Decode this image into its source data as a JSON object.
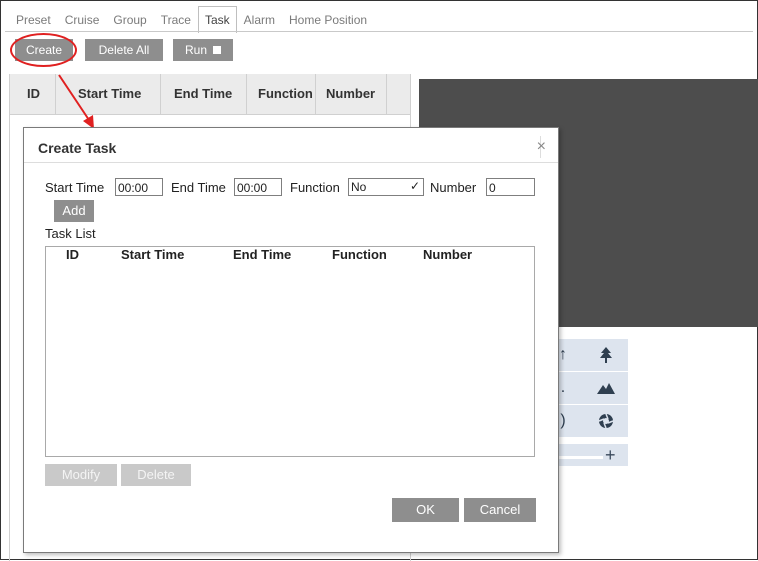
{
  "tabs": [
    {
      "label": "Preset",
      "active": false
    },
    {
      "label": "Cruise",
      "active": false
    },
    {
      "label": "Group",
      "active": false
    },
    {
      "label": "Trace",
      "active": false
    },
    {
      "label": "Task",
      "active": true
    },
    {
      "label": "Alarm",
      "active": false
    },
    {
      "label": "Home Position",
      "active": false
    }
  ],
  "toolbar": {
    "create_label": "Create",
    "delete_all_label": "Delete All",
    "run_label": "Run"
  },
  "background_table": {
    "columns": [
      "ID",
      "Start Time",
      "End Time",
      "Function",
      "Number"
    ]
  },
  "ptz_icons": [
    "tree-small-icon",
    "tree-large-icon",
    "mountain-small-icon",
    "mountain-large-icon",
    "iris-close-icon",
    "iris-open-icon"
  ],
  "zoom_plus": "+",
  "modal": {
    "title": "Create Task",
    "close_symbol": "×",
    "start_time_label": "Start Time",
    "start_time_value": "00:00",
    "end_time_label": "End Time",
    "end_time_value": "00:00",
    "function_label": "Function",
    "function_value": "No",
    "number_label": "Number",
    "number_value": "0",
    "add_label": "Add",
    "task_list_label": "Task List",
    "task_list_columns": [
      "ID",
      "Start Time",
      "End Time",
      "Function",
      "Number"
    ],
    "modify_label": "Modify",
    "delete_label": "Delete",
    "ok_label": "OK",
    "cancel_label": "Cancel"
  },
  "colors": {
    "highlight": "#e02020",
    "button_bg": "#8e8e8e",
    "video_bg": "#4d4d4d",
    "ptz_bg": "#dde4ee"
  }
}
